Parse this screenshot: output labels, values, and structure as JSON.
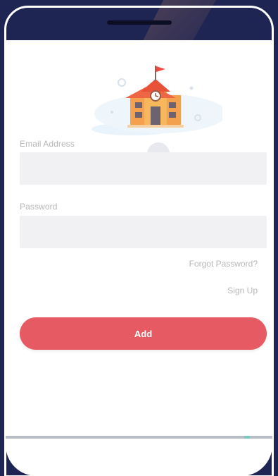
{
  "login": {
    "email_label": "Email Address",
    "email_value": "",
    "password_label": "Password",
    "password_value": "",
    "forgot_password_label": "Forgot Password?",
    "sign_up_label": "Sign Up",
    "submit_label": "Add"
  },
  "colors": {
    "background": "#1f2553",
    "screen": "#ffffff",
    "field": "#f1f1f3",
    "accent": "#e65a63"
  },
  "icons": {
    "illustration": "school-building-icon"
  }
}
